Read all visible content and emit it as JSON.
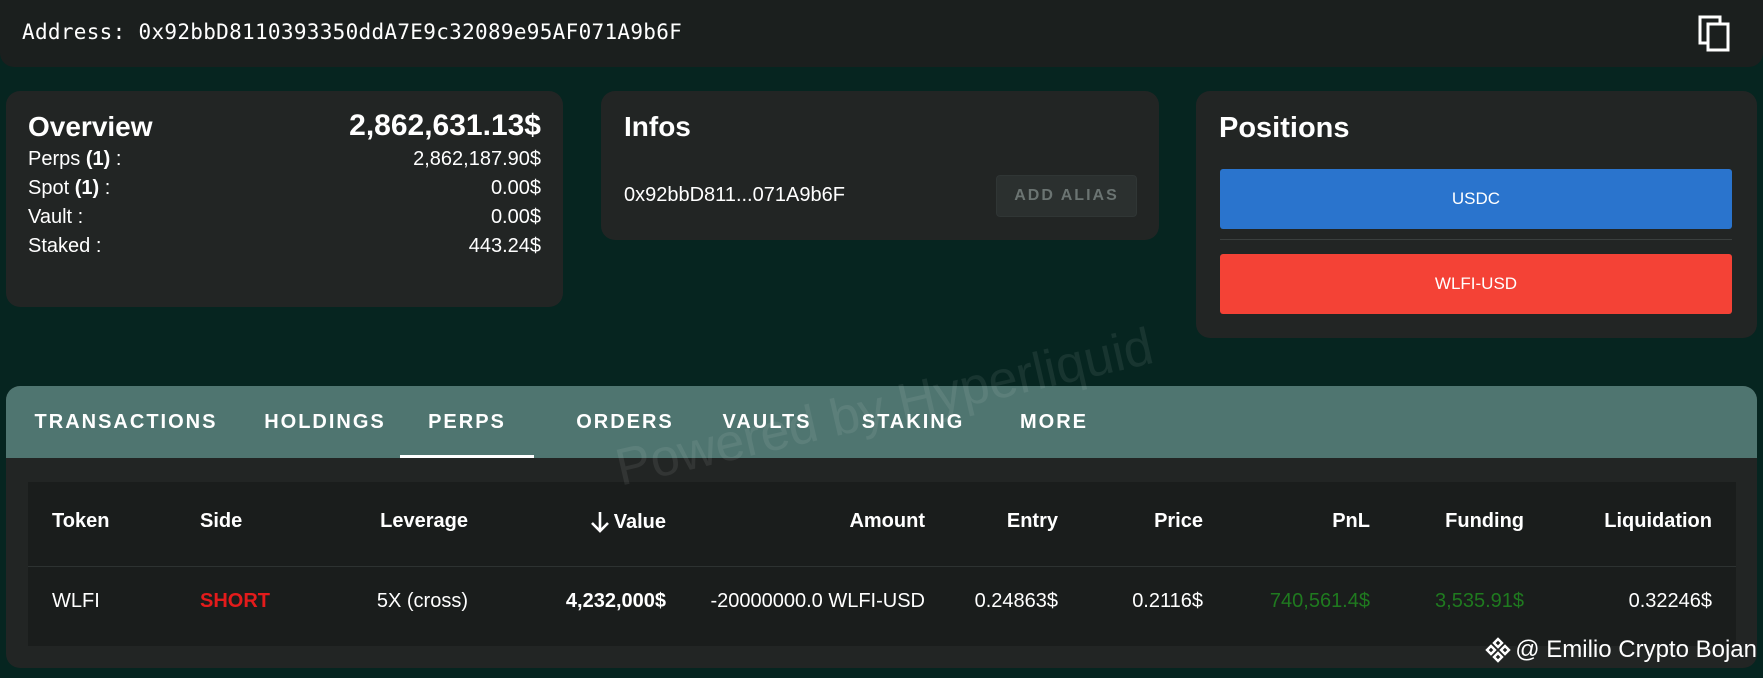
{
  "address_bar": {
    "label": "Address:",
    "address": "0x92bbD8110393350ddA7E9c32089e95AF071A9b6F",
    "copy_icon": "copy-icon"
  },
  "overview": {
    "title": "Overview",
    "total": "2,862,631.13$",
    "rows": [
      {
        "label": "Perps",
        "count": "(1)",
        "suffix": " :",
        "value": "2,862,187.90$"
      },
      {
        "label": "Spot",
        "count": "(1)",
        "suffix": " :",
        "value": "0.00$"
      },
      {
        "label": "Vault :",
        "count": "",
        "suffix": "",
        "value": "0.00$"
      },
      {
        "label": "Staked :",
        "count": "",
        "suffix": "",
        "value": "443.24$"
      }
    ]
  },
  "infos": {
    "title": "Infos",
    "short_address": "0x92bbD811...071A9b6F",
    "add_alias_label": "ADD ALIAS"
  },
  "positions": {
    "title": "Positions",
    "items": [
      {
        "label": "USDC",
        "color": "#2a74cd"
      },
      {
        "label": "WLFI-USD",
        "color": "#f44236"
      }
    ]
  },
  "tabs": [
    {
      "label": "TRANSACTIONS",
      "active": false
    },
    {
      "label": "HOLDINGS",
      "active": false
    },
    {
      "label": "PERPS",
      "active": true
    },
    {
      "label": "ORDERS",
      "active": false
    },
    {
      "label": "VAULTS",
      "active": false
    },
    {
      "label": "STAKING",
      "active": false
    },
    {
      "label": "MORE",
      "active": false
    }
  ],
  "perps_table": {
    "sort_icon": "arrow-down-icon",
    "headers": {
      "token": "Token",
      "side": "Side",
      "leverage": "Leverage",
      "value": "Value",
      "amount": "Amount",
      "entry": "Entry",
      "price": "Price",
      "pnl": "PnL",
      "funding": "Funding",
      "liquidation": "Liquidation"
    },
    "rows": [
      {
        "token": "WLFI",
        "side": "SHORT",
        "leverage": "5X (cross)",
        "value": "4,232,000$",
        "amount": "-20000000.0 WLFI-USD",
        "entry": "0.24863$",
        "price": "0.2116$",
        "pnl": "740,561.4$",
        "funding": "3,535.91$",
        "liquidation": "0.32246$"
      }
    ]
  },
  "watermark": "Powered by Hyperliquid",
  "credit": "@ Emilio Crypto Bojan",
  "colors": {
    "background": "#062520",
    "card": "#222524",
    "tab_bar": "#4f7570",
    "short": "#e31b1b",
    "positive": "#1f7a1f"
  }
}
